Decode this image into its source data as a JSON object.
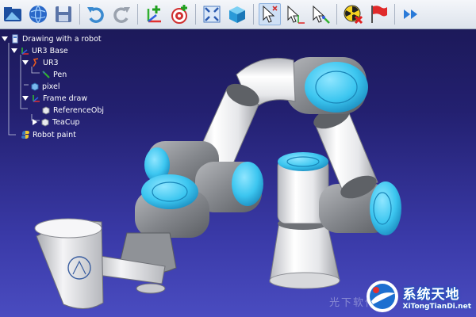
{
  "tree": {
    "items": [
      {
        "label": "Drawing with a robot",
        "icon": "station-icon"
      },
      {
        "label": "UR3 Base",
        "icon": "frame-icon"
      },
      {
        "label": "UR3",
        "icon": "robot-icon"
      },
      {
        "label": "Pen",
        "icon": "tool-icon"
      },
      {
        "label": "pixel",
        "icon": "object-icon"
      },
      {
        "label": "Frame draw",
        "icon": "frame-icon"
      },
      {
        "label": "ReferenceObj",
        "icon": "object-icon"
      },
      {
        "label": "TeaCup",
        "icon": "object-icon"
      },
      {
        "label": "Robot paint",
        "icon": "python-program-icon"
      }
    ]
  },
  "toolbar": {
    "buttons": [
      "open-station-icon",
      "open-online-library-icon",
      "save-icon",
      "undo-icon",
      "redo-icon",
      "add-reference-frame-icon",
      "add-target-icon",
      "fit-all-icon",
      "isometric-view-icon",
      "select-icon",
      "move-reference-frame-icon",
      "move-tool-icon",
      "check-collisions-icon",
      "red-flag-icon",
      "fast-forward-icon"
    ]
  },
  "watermark": {
    "title": "系统天地",
    "subtitle": "XiTongTianDi.net",
    "faint": "光下软件园"
  },
  "colors": {
    "background_top": "#1a1752",
    "background_bottom": "#4a4cc0",
    "robot_accent": "#3cc6f0",
    "robot_body": "#e8e8ea",
    "robot_joint": "#8a8d92"
  }
}
